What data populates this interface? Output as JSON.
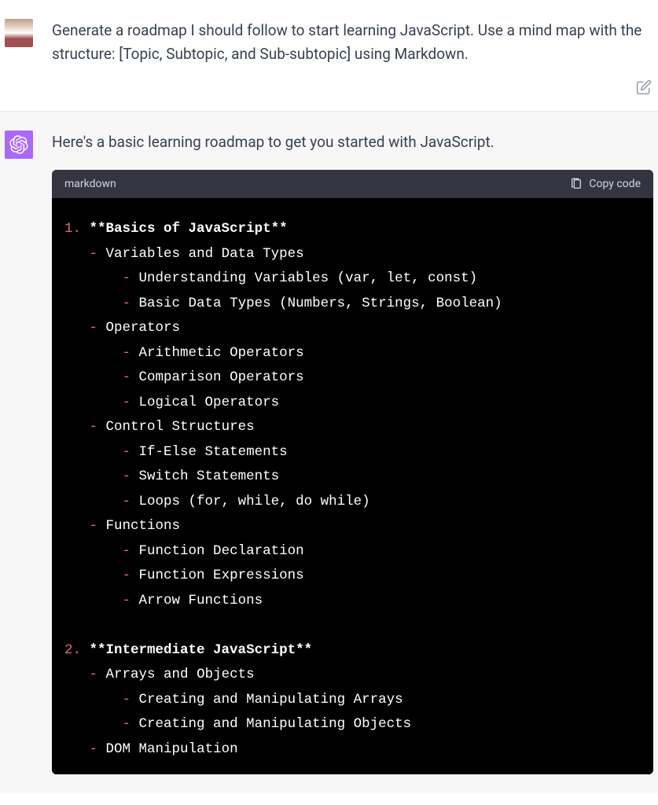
{
  "user_message": "Generate a roadmap I should follow to start learning JavaScript. Use a mind map with the structure: [Topic, Subtopic, and Sub-subtopic] using Markdown.",
  "assistant_intro": "Here's a basic learning roadmap to get you started with JavaScript.",
  "code_lang": "markdown",
  "copy_label": "Copy code",
  "roadmap": {
    "sections": [
      {
        "num": "1.",
        "title": "**Basics of JavaScript**",
        "subtopics": [
          {
            "label": "Variables and Data Types",
            "items": [
              "Understanding Variables (var, let, const)",
              "Basic Data Types (Numbers, Strings, Boolean)"
            ]
          },
          {
            "label": "Operators",
            "items": [
              "Arithmetic Operators",
              "Comparison Operators",
              "Logical Operators"
            ]
          },
          {
            "label": "Control Structures",
            "items": [
              "If-Else Statements",
              "Switch Statements",
              "Loops (for, while, do while)"
            ]
          },
          {
            "label": "Functions",
            "items": [
              "Function Declaration",
              "Function Expressions",
              "Arrow Functions"
            ]
          }
        ]
      },
      {
        "num": "2.",
        "title": "**Intermediate JavaScript**",
        "subtopics": [
          {
            "label": "Arrays and Objects",
            "items": [
              "Creating and Manipulating Arrays",
              "Creating and Manipulating Objects"
            ]
          },
          {
            "label": "DOM Manipulation",
            "items": []
          }
        ]
      }
    ]
  }
}
